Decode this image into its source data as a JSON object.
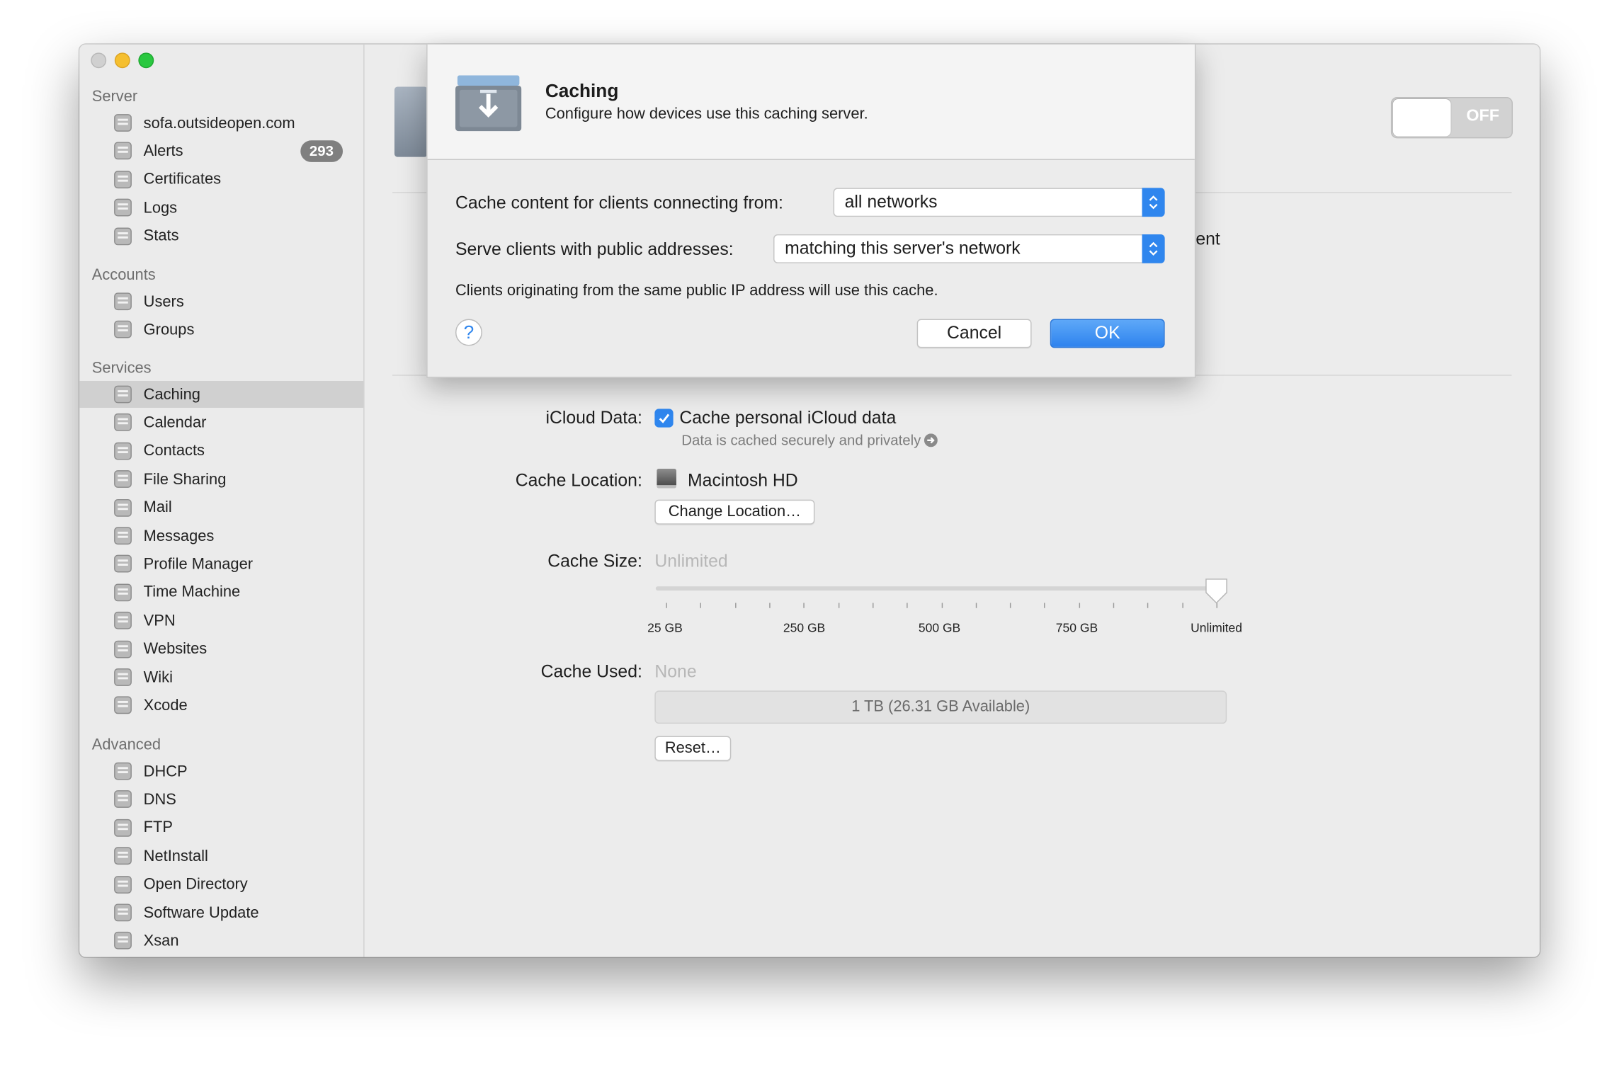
{
  "sidebar": {
    "sections": [
      {
        "title": "Server",
        "items": [
          {
            "label": "sofa.outsideopen.com",
            "icon": "server-icon"
          },
          {
            "label": "Alerts",
            "icon": "megaphone-icon",
            "badge": "293"
          },
          {
            "label": "Certificates",
            "icon": "certificate-icon"
          },
          {
            "label": "Logs",
            "icon": "log-icon"
          },
          {
            "label": "Stats",
            "icon": "stats-icon"
          }
        ]
      },
      {
        "title": "Accounts",
        "items": [
          {
            "label": "Users",
            "icon": "user-icon"
          },
          {
            "label": "Groups",
            "icon": "group-icon"
          }
        ]
      },
      {
        "title": "Services",
        "items": [
          {
            "label": "Caching",
            "icon": "caching-icon"
          },
          {
            "label": "Calendar",
            "icon": "calendar-icon"
          },
          {
            "label": "Contacts",
            "icon": "contacts-icon"
          },
          {
            "label": "File Sharing",
            "icon": "file-sharing-icon"
          },
          {
            "label": "Mail",
            "icon": "mail-icon"
          },
          {
            "label": "Messages",
            "icon": "messages-icon"
          },
          {
            "label": "Profile Manager",
            "icon": "profile-manager-icon"
          },
          {
            "label": "Time Machine",
            "icon": "time-machine-icon"
          },
          {
            "label": "VPN",
            "icon": "vpn-icon"
          },
          {
            "label": "Websites",
            "icon": "websites-icon"
          },
          {
            "label": "Wiki",
            "icon": "wiki-icon"
          },
          {
            "label": "Xcode",
            "icon": "xcode-icon"
          }
        ]
      },
      {
        "title": "Advanced",
        "items": [
          {
            "label": "DHCP",
            "icon": "dhcp-icon"
          },
          {
            "label": "DNS",
            "icon": "dns-icon"
          },
          {
            "label": "FTP",
            "icon": "ftp-icon"
          },
          {
            "label": "NetInstall",
            "icon": "netinstall-icon"
          },
          {
            "label": "Open Directory",
            "icon": "open-directory-icon"
          },
          {
            "label": "Software Update",
            "icon": "software-update-icon"
          },
          {
            "label": "Xsan",
            "icon": "xsan-icon"
          }
        ]
      }
    ],
    "selected": "Caching"
  },
  "main": {
    "toggle_label": "OFF",
    "hidden_text_fragment": "ent",
    "icloud": {
      "label": "iCloud Data:",
      "checkbox_label": "Cache personal iCloud data",
      "checked": true,
      "note": "Data is cached securely and privately"
    },
    "location": {
      "label": "Cache Location:",
      "value": "Macintosh HD",
      "change_button": "Change Location…"
    },
    "size": {
      "label": "Cache Size:",
      "value": "Unlimited",
      "tick_labels": [
        "25 GB",
        "250 GB",
        "500 GB",
        "750 GB",
        "Unlimited"
      ],
      "slider_fraction": 1.0
    },
    "used": {
      "label": "Cache Used:",
      "value": "None",
      "bar_text": "1 TB (26.31 GB Available)",
      "reset_button": "Reset…"
    }
  },
  "sheet": {
    "title": "Caching",
    "subtitle": "Configure how devices use this caching server.",
    "row1_label": "Cache content for clients connecting from:",
    "row1_value": "all networks",
    "row2_label": "Serve clients with public addresses:",
    "row2_value": "matching this server's network",
    "info": "Clients originating from the same public IP address will use this cache.",
    "help": "?",
    "cancel": "Cancel",
    "ok": "OK"
  },
  "colors": {
    "accent": "#2f86ee",
    "selection": "#d0d0d0",
    "badge": "#7f7f7f"
  }
}
